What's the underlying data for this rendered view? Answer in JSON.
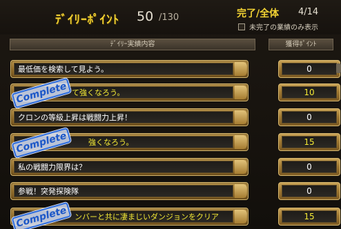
{
  "header": {
    "title": "ﾃﾞｲﾘｰﾎﾟｲﾝﾄ",
    "points_current": "50",
    "points_max": "/130",
    "completion_label": "完了/全体",
    "completion_count": "4/14",
    "hide_completed_label": "未完了の業績のみ表示"
  },
  "columns": {
    "task": "ﾃﾞｲﾘｰ実績内容",
    "points": "獲得ﾎﾟｲﾝﾄ"
  },
  "stamp_text": "Complete",
  "rows": [
    {
      "text": "最低価を検索して見よう。",
      "points": "0",
      "complete": false
    },
    {
      "text": "て強くなろう。",
      "points": "10",
      "complete": true
    },
    {
      "text": "クロンの等級上昇は戦闘力上昇！",
      "points": "0",
      "complete": false
    },
    {
      "text": "強くなろう。",
      "points": "15",
      "complete": true
    },
    {
      "text": "私の戦闘力限界は？",
      "points": "0",
      "complete": false
    },
    {
      "text": "参戦！突発探険隊",
      "points": "0",
      "complete": false
    },
    {
      "text": "ンバーと共に凄まじいダンジョンをクリア",
      "points": "15",
      "complete": true
    }
  ],
  "colors": {
    "accent_gold": "#f2d233",
    "stamp_blue": "#1d58c8",
    "complete_text": "#f4ea35"
  }
}
